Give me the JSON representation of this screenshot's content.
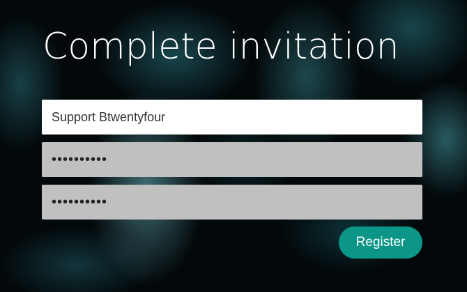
{
  "page": {
    "title": "Complete invitation"
  },
  "form": {
    "username_value": "Support Btwentyfour",
    "password_value": "••••••••••",
    "confirm_password_value": "••••••••••",
    "register_label": "Register"
  },
  "colors": {
    "button_accent": "#0c9688",
    "password_field_bg": "#c0c0c0",
    "username_field_bg": "#ffffff"
  }
}
